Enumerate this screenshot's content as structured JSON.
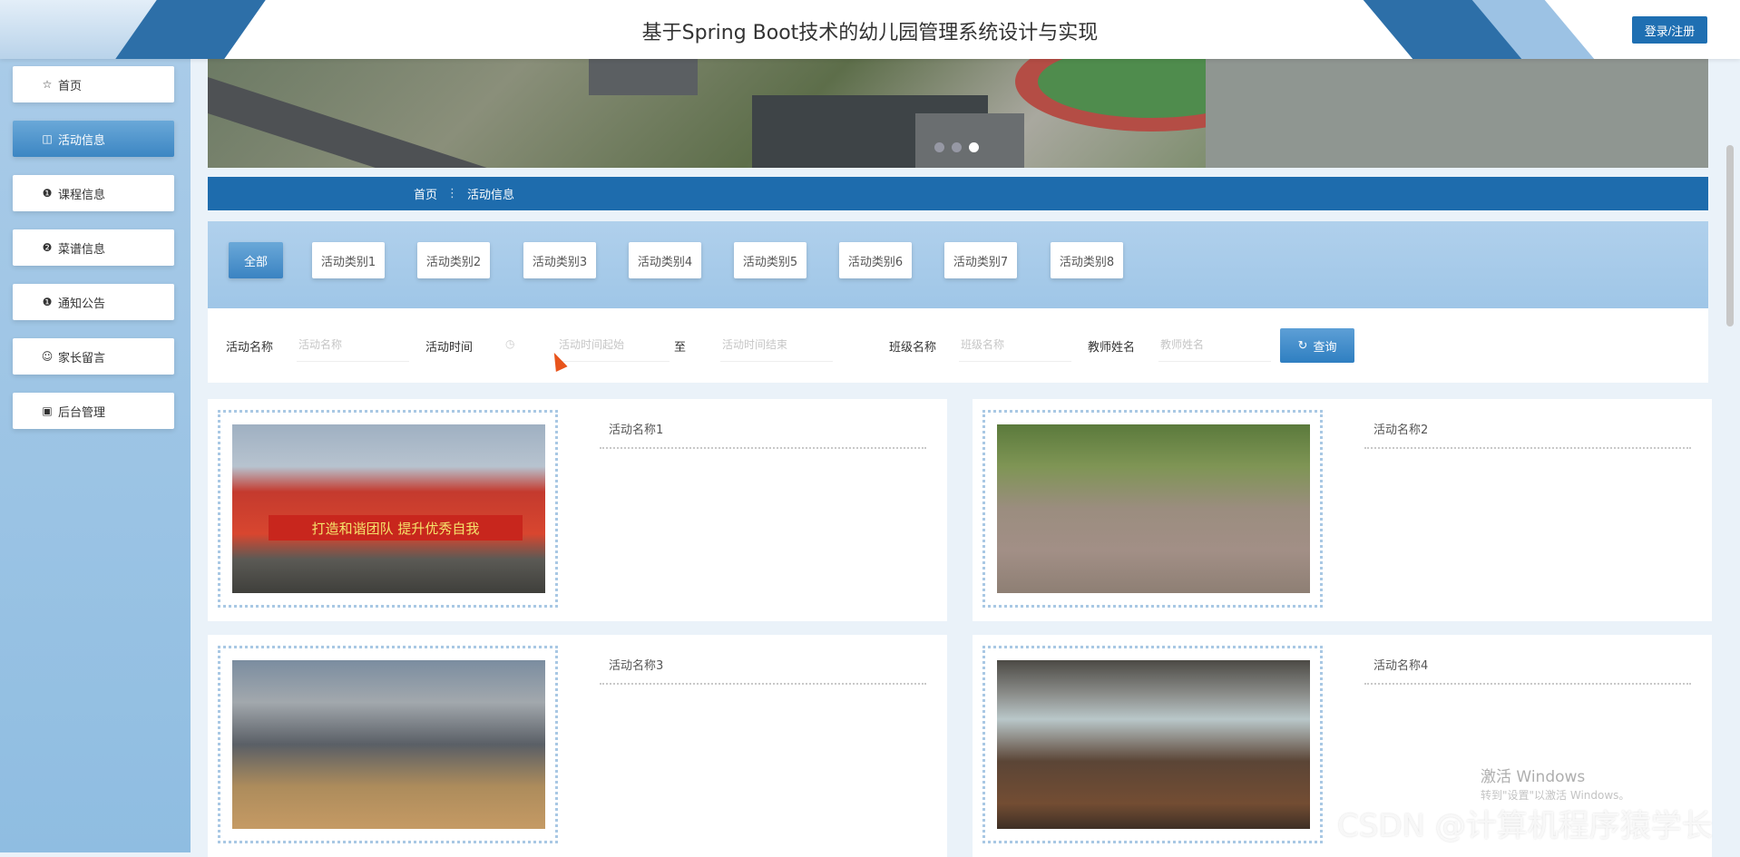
{
  "header": {
    "title": "基于Spring Boot技术的幼儿园管理系统设计与实现",
    "login_label": "登录/注册"
  },
  "sidebar": {
    "items": [
      {
        "label": "首页",
        "icon": "star-icon",
        "glyph": "☆",
        "active": false
      },
      {
        "label": "活动信息",
        "icon": "bag-icon",
        "glyph": "▭",
        "active": true
      },
      {
        "label": "课程信息",
        "icon": "info-icon",
        "glyph": "●",
        "active": false
      },
      {
        "label": "菜谱信息",
        "icon": "question-icon",
        "glyph": "●",
        "active": false
      },
      {
        "label": "通知公告",
        "icon": "info-icon",
        "glyph": "●",
        "active": false
      },
      {
        "label": "家长留言",
        "icon": "smile-icon",
        "glyph": "☺",
        "active": false
      },
      {
        "label": "后台管理",
        "icon": "calendar-icon",
        "glyph": "▣",
        "active": false
      }
    ]
  },
  "banner": {
    "dots": 3,
    "active_dot": 3
  },
  "breadcrumb": {
    "home": "首页",
    "separator": "⋮",
    "current": "活动信息"
  },
  "categories": {
    "tabs": [
      "全部",
      "活动类别1",
      "活动类别2",
      "活动类别3",
      "活动类别4",
      "活动类别5",
      "活动类别6",
      "活动类别7",
      "活动类别8"
    ],
    "active_index": 0
  },
  "search": {
    "name_label": "活动名称",
    "name_placeholder": "活动名称",
    "time_label": "活动时间",
    "time_start_placeholder": "活动时间起始",
    "time_to": "至",
    "time_end_placeholder": "活动时间结束",
    "class_label": "班级名称",
    "class_placeholder": "班级名称",
    "teacher_label": "教师姓名",
    "teacher_placeholder": "教师姓名",
    "query_label": "查询"
  },
  "cards": [
    {
      "name": "活动名称1",
      "photo_text": "打造和谐团队 提升优秀自我"
    },
    {
      "name": "活动名称2"
    },
    {
      "name": "活动名称3"
    },
    {
      "name": "活动名称4"
    }
  ],
  "overlay": {
    "activate_title": "激活 Windows",
    "activate_sub": "转到\"设置\"以激活 Windows。",
    "csdn_watermark": "CSDN @计算机程序猿学长"
  },
  "colors": {
    "primary": "#1e6cad",
    "accent": "#3a83c2",
    "sidebar_bg": "#a9cbe8"
  }
}
